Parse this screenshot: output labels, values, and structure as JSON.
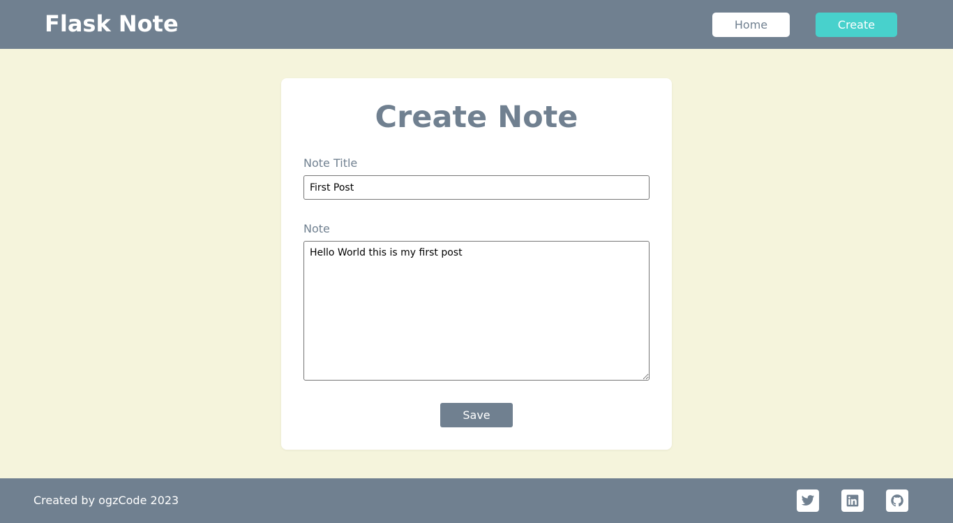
{
  "navbar": {
    "brand": "Flask Note",
    "home_label": "Home",
    "create_label": "Create",
    "accent_color": "#48d1cc",
    "bar_color": "#708090"
  },
  "form": {
    "heading": "Create Note",
    "title_label": "Note Title",
    "title_value": "First Post",
    "note_label": "Note",
    "note_value": "Hello World this is my first post",
    "save_label": "Save"
  },
  "footer": {
    "credit": "Created by ogzCode 2023",
    "social_icons": [
      "twitter-icon",
      "linkedin-icon",
      "github-icon"
    ]
  },
  "page": {
    "background_color": "#f5f4dc"
  }
}
